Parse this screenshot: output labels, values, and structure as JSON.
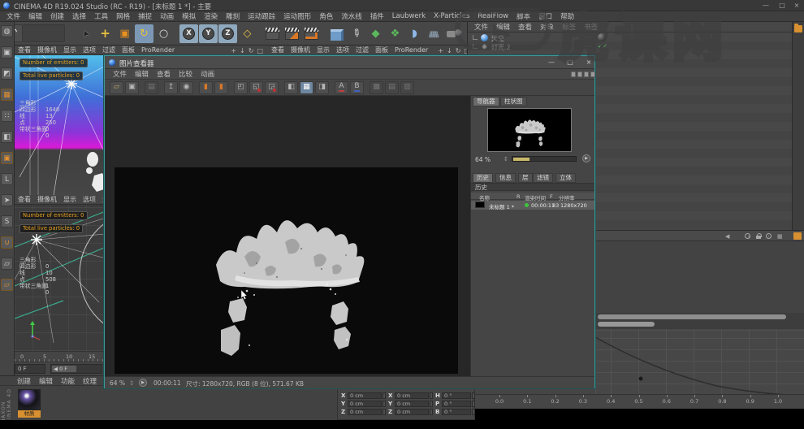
{
  "window": {
    "title": "CINEMA 4D R19.024 Studio (RC - R19) - [未标题 1 *] - 主要",
    "controls": [
      "—",
      "□",
      "×"
    ]
  },
  "menu_bar": [
    "文件",
    "编辑",
    "创建",
    "选择",
    "工具",
    "网格",
    "捕捉",
    "动画",
    "模拟",
    "渲染",
    "雕刻",
    "运动跟踪",
    "运动图形",
    "角色",
    "流水线",
    "插件",
    "Laubwerk",
    "X-Particles",
    "RealFlow",
    "脚本",
    "窗口",
    "帮助"
  ],
  "main_toolbar": {
    "undo_glyph": "↶",
    "icons": [
      {
        "name": "select-tool-icon",
        "glyph": "➤",
        "cls": "cursor"
      },
      {
        "name": "move-tool-icon",
        "glyph": "+",
        "cls": "move"
      },
      {
        "name": "scale-tool-icon",
        "glyph": "▣",
        "cls": "scale"
      },
      {
        "name": "rotate-tool-icon",
        "glyph": "↻",
        "cls": "rotate"
      },
      {
        "name": "last-used-tool-icon",
        "glyph": "○",
        "cls": "plain"
      },
      {
        "name": "separator"
      },
      {
        "name": "x-axis-lock-button",
        "glyph": "X",
        "cls": "axis"
      },
      {
        "name": "y-axis-lock-button",
        "glyph": "Y",
        "cls": "axis"
      },
      {
        "name": "z-axis-lock-button",
        "glyph": "Z",
        "cls": "axis"
      },
      {
        "name": "coordinate-system-button",
        "glyph": "◇",
        "cls": "coord"
      },
      {
        "name": "separator"
      },
      {
        "name": "render-view-button",
        "glyph": "",
        "cls": "clap"
      },
      {
        "name": "render-to-picture-viewer-button",
        "glyph": "",
        "cls": "clap clap-o"
      },
      {
        "name": "render-settings-button",
        "glyph": "",
        "cls": "clap clap-g"
      },
      {
        "name": "separator"
      },
      {
        "name": "add-primitive-cube-button",
        "glyph": "",
        "cls": "cube"
      },
      {
        "name": "spline-pen-button",
        "glyph": "✎",
        "cls": "pen"
      },
      {
        "name": "generators-button",
        "glyph": "◆",
        "cls": "green"
      },
      {
        "name": "mograph-button",
        "glyph": "❖",
        "cls": "green"
      },
      {
        "name": "deformers-button",
        "glyph": "◗",
        "cls": "blue"
      },
      {
        "name": "environment-button",
        "glyph": "▦",
        "cls": "plane"
      },
      {
        "name": "camera-button",
        "glyph": "",
        "cls": "cam"
      },
      {
        "name": "light-button",
        "glyph": "",
        "cls": "bulb"
      }
    ]
  },
  "mode_toolbar": [
    {
      "name": "make-editable-icon",
      "glyph": "◍"
    },
    {
      "name": "model-mode-icon",
      "glyph": "▣"
    },
    {
      "name": "texture-mode-icon",
      "glyph": "◩"
    },
    {
      "name": "workplane-mode-icon",
      "glyph": "▦",
      "orange": true
    },
    {
      "name": "points-mode-icon",
      "glyph": "∷"
    },
    {
      "name": "edges-mode-icon",
      "glyph": "◧"
    },
    {
      "name": "polygons-mode-icon",
      "glyph": "▣",
      "orange": true
    },
    {
      "name": "axis-mode-icon",
      "glyph": "L"
    },
    {
      "name": "viewport-solo-icon",
      "glyph": "➤"
    },
    {
      "name": "snap-settings-icon",
      "glyph": "S"
    },
    {
      "name": "snap-toggle-icon",
      "glyph": "∪",
      "orange": true
    },
    {
      "name": "workplane-icon",
      "glyph": "▱"
    },
    {
      "name": "locked-workplane-icon",
      "glyph": "▱",
      "orange": true
    }
  ],
  "viewport_menu": [
    "查看",
    "摄像机",
    "显示",
    "选项",
    "过滤",
    "面板",
    "ProRender"
  ],
  "viewport_corner_icons": [
    {
      "name": "pan-view-icon",
      "glyph": "+"
    },
    {
      "name": "zoom-view-icon",
      "glyph": "↓"
    },
    {
      "name": "rotate-view-icon",
      "glyph": "↻"
    },
    {
      "name": "maximize-view-icon",
      "glyph": "□"
    }
  ],
  "hud": [
    "Number of emitters: 0",
    "Total live particles: 0"
  ],
  "viewport_top": {
    "stats": [
      {
        "label": "三角形",
        "value": "1640"
      },
      {
        "label": "四边形",
        "value": "13"
      },
      {
        "label": "线",
        "value": "250"
      },
      {
        "label": "点",
        "value": "0"
      },
      {
        "label": "带状三角面",
        "value": "0"
      }
    ]
  },
  "viewport_bottom": {
    "stats": [
      {
        "label": "三角形",
        "value": "0"
      },
      {
        "label": "四边形",
        "value": "10"
      },
      {
        "label": "线",
        "value": "508"
      },
      {
        "label": "点",
        "value": "1"
      },
      {
        "label": "带状三角面",
        "value": "0"
      }
    ]
  },
  "timeline": {
    "ticks": [
      "0",
      "5",
      "10",
      "15"
    ],
    "frame": "0 F",
    "slider_label": "◀ 0 F"
  },
  "material_manager": {
    "menu": [
      "创建",
      "编辑",
      "功能",
      "纹理"
    ],
    "materials": [
      {
        "name": "材质"
      }
    ]
  },
  "branding": "MAXON CINEMA 4D",
  "coordinate_manager": {
    "groups": [
      {
        "name": "position",
        "labels": [
          "X",
          "Y",
          "Z"
        ],
        "values": [
          "0 cm",
          "0 cm",
          "0 cm"
        ]
      },
      {
        "name": "scale",
        "labels": [
          "X",
          "Y",
          "Z"
        ],
        "values": [
          "0 cm",
          "0 cm",
          "0 cm"
        ]
      },
      {
        "name": "rotation",
        "labels": [
          "H",
          "P",
          "B"
        ],
        "values": [
          "0 °",
          "0 °",
          "0 °"
        ]
      }
    ]
  },
  "object_manager": {
    "menu": [
      "文件",
      "编辑",
      "查看",
      "对象",
      "标签",
      "书签"
    ],
    "objects": [
      {
        "name": "天空",
        "icon": "sky-icon",
        "tag": "sphere-tag",
        "tag_text": ""
      },
      {
        "name": "灯光.2",
        "icon": "light-icon",
        "tag": "check-tag",
        "tag_text": "✓✓"
      }
    ]
  },
  "picture_viewer": {
    "title": "图片查看器",
    "controls": [
      "—",
      "□",
      "×"
    ],
    "menu": [
      "文件",
      "编辑",
      "查看",
      "比较",
      "动画"
    ],
    "toolbar": [
      {
        "name": "open-file-button",
        "glyph": "▱",
        "cls": "amber"
      },
      {
        "name": "save-button",
        "glyph": "▣",
        "cls": ""
      },
      {
        "name": "gap"
      },
      {
        "name": "thumbnail-view-button",
        "glyph": "▤",
        "cls": "dim"
      },
      {
        "name": "gap"
      },
      {
        "name": "upload-button",
        "glyph": "↥",
        "cls": ""
      },
      {
        "name": "user-button",
        "glyph": "◉",
        "cls": ""
      },
      {
        "name": "gap"
      },
      {
        "name": "full-image-button",
        "glyph": "▮",
        "cls": "orange"
      },
      {
        "name": "exit-compare-button",
        "glyph": "▮",
        "cls": "orange"
      },
      {
        "name": "gap"
      },
      {
        "name": "film-frame-button",
        "glyph": "◰",
        "cls": ""
      },
      {
        "name": "film-marker-button",
        "glyph": "◱",
        "cls": "reddot"
      },
      {
        "name": "film-person-button",
        "glyph": "◲",
        "cls": "reddot"
      },
      {
        "name": "gap"
      },
      {
        "name": "compare-split-button",
        "glyph": "◧",
        "cls": ""
      },
      {
        "name": "grid-view-button",
        "glyph": "▦",
        "cls": "activeblue"
      },
      {
        "name": "compare-ab-button",
        "glyph": "◨",
        "cls": ""
      },
      {
        "name": "gap"
      },
      {
        "name": "set-a-image-button",
        "glyph": "A",
        "cls": "redu"
      },
      {
        "name": "set-b-image-button",
        "glyph": "B",
        "cls": "bluu"
      },
      {
        "name": "gap"
      },
      {
        "name": "layer-option-1-button",
        "glyph": "▩",
        "cls": "dim"
      },
      {
        "name": "layer-option-2-button",
        "glyph": "▤",
        "cls": "dim"
      },
      {
        "name": "layer-option-3-button",
        "glyph": "▥",
        "cls": "dim"
      }
    ],
    "right_tabs": [
      "导航器",
      "柱状图"
    ],
    "zoom_value": "64 %",
    "panel_tabs": [
      "历史",
      "信息",
      "层",
      "滤镜",
      "立体"
    ],
    "history": {
      "header": "历史",
      "columns": [
        "名称",
        "R",
        "渲染时间",
        "F",
        "分辨率"
      ],
      "rows": [
        {
          "name": "未标题 1 *",
          "render_time": "00:00:11",
          "frames": "83",
          "resolution": "1280x720"
        }
      ]
    },
    "status": {
      "zoom": "64 %",
      "time": "00:00:11",
      "info": "尺寸: 1280x720, RGB (8 位), 571.67 KB"
    }
  },
  "fcurve_ruler": [
    "0.0",
    "0.1",
    "0.2",
    "0.3",
    "0.4",
    "0.5",
    "0.6",
    "0.7",
    "0.8",
    "0.9",
    "1.0"
  ],
  "watermark": {
    "text": "虎课网"
  },
  "colors": {
    "accent_orange": "#d89030",
    "active_blue": "#6e87a0",
    "highlight_teal": "#3f9a9a",
    "hud_yellow": "#e8a020",
    "status_green": "#3cc43c",
    "viewport_gradient_top": "#52c0ea",
    "viewport_gradient_bottom": "#d81ad8"
  }
}
